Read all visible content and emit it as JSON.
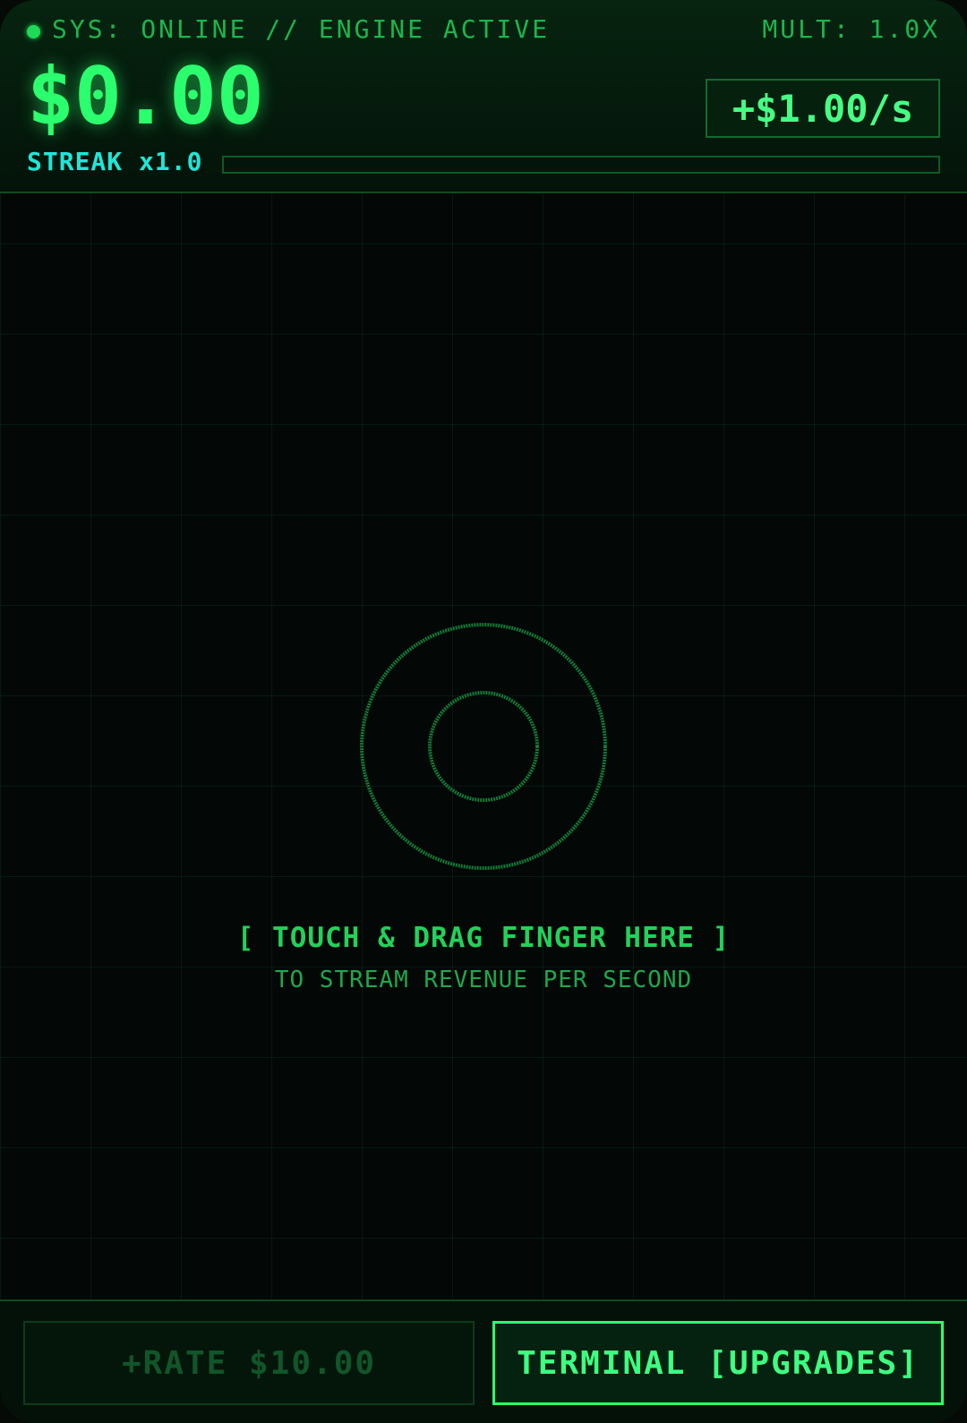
{
  "header": {
    "status": "SYS: ONLINE // ENGINE ACTIVE",
    "multiplier": "MULT: 1.0X",
    "balance": "$0.00",
    "rate": "+$1.00/s",
    "streak_label": "STREAK x1.0",
    "streak_progress_percent": 0
  },
  "play_area": {
    "prompt_main": "[ TOUCH & DRAG FINGER HERE ]",
    "prompt_sub": "TO STREAM REVENUE PER SECOND"
  },
  "footer": {
    "rate_upgrade_label": "+RATE $10.00",
    "terminal_label": "TERMINAL [UPGRADES]"
  },
  "icons": {
    "status": "status-dot-icon",
    "touch_target": "target-rings-icon"
  },
  "colors": {
    "primary": "#2bff6e",
    "accent": "#1fe6d8",
    "dim": "#1cb54d",
    "disabled": "#11552a",
    "background": "#030605"
  }
}
